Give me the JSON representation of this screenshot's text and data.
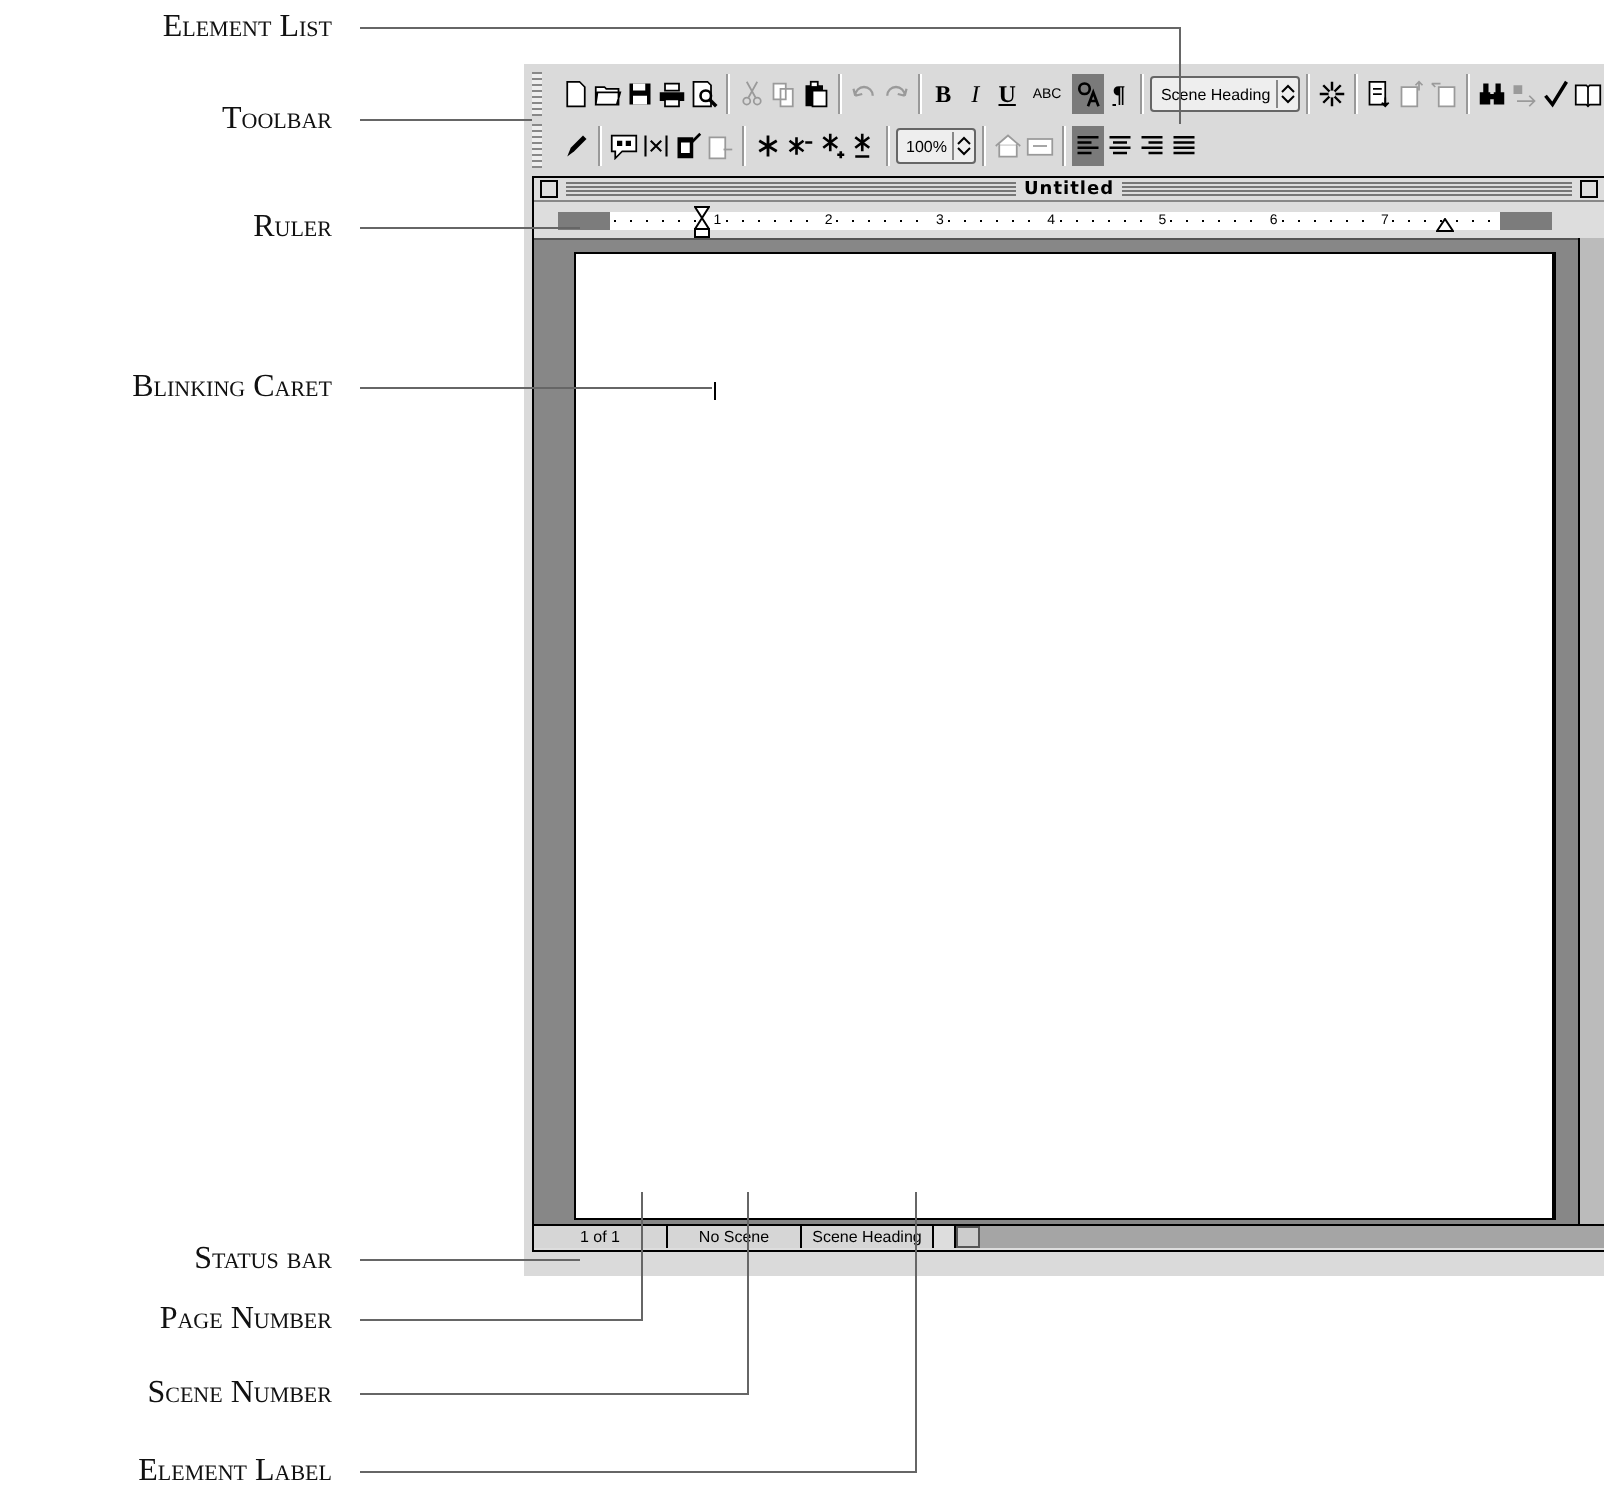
{
  "callouts": [
    {
      "label": "Element List"
    },
    {
      "label": "Toolbar"
    },
    {
      "label": "Ruler"
    },
    {
      "label": "Blinking Caret"
    },
    {
      "label": "Status bar"
    },
    {
      "label": "Page Number"
    },
    {
      "label": "Scene Number"
    },
    {
      "label": "Element Label"
    }
  ],
  "toolbar": {
    "rows": [
      [
        {
          "kind": "icon",
          "on": false,
          "disabled": false
        },
        {
          "kind": "icon",
          "on": false,
          "disabled": false
        },
        {
          "kind": "icon",
          "on": false,
          "disabled": false
        },
        {
          "kind": "icon",
          "on": false,
          "disabled": false
        },
        {
          "kind": "icon",
          "on": false,
          "disabled": false
        },
        {
          "kind": "separator"
        },
        {
          "kind": "icon",
          "on": false,
          "disabled": true
        },
        {
          "kind": "icon",
          "on": false,
          "disabled": true
        },
        {
          "kind": "icon",
          "on": false,
          "disabled": false
        },
        {
          "kind": "separator"
        },
        {
          "kind": "icon",
          "on": false,
          "disabled": true
        },
        {
          "kind": "icon",
          "on": false,
          "disabled": true
        },
        {
          "kind": "separator"
        },
        {
          "kind": "glyph",
          "text": "B",
          "on": false,
          "disabled": false
        },
        {
          "kind": "glyph",
          "text": "I",
          "on": false,
          "disabled": false
        },
        {
          "kind": "glyph",
          "text": "U",
          "on": false,
          "disabled": false
        },
        {
          "kind": "glyph",
          "text": "ABC",
          "on": false,
          "disabled": false
        },
        {
          "kind": "icon",
          "on": true,
          "disabled": false
        },
        {
          "kind": "glyph",
          "text": "¶",
          "on": false,
          "disabled": false
        },
        {
          "kind": "separator"
        },
        {
          "kind": "popup",
          "value": "Scene Heading"
        },
        {
          "kind": "separator"
        },
        {
          "kind": "icon",
          "on": false,
          "disabled": false
        },
        {
          "kind": "separator"
        },
        {
          "kind": "icon",
          "on": false,
          "disabled": false
        },
        {
          "kind": "icon",
          "on": false,
          "disabled": true
        },
        {
          "kind": "icon",
          "on": false,
          "disabled": true
        },
        {
          "kind": "separator"
        },
        {
          "kind": "icon",
          "on": false,
          "disabled": false
        },
        {
          "kind": "icon",
          "on": false,
          "disabled": true
        },
        {
          "kind": "icon",
          "on": false,
          "disabled": false
        },
        {
          "kind": "icon",
          "on": false,
          "disabled": false
        }
      ],
      [
        {
          "kind": "icon",
          "on": false,
          "disabled": false
        },
        {
          "kind": "separator"
        },
        {
          "kind": "icon",
          "on": false,
          "disabled": false
        },
        {
          "kind": "icon",
          "on": false,
          "disabled": false
        },
        {
          "kind": "icon",
          "on": false,
          "disabled": false
        },
        {
          "kind": "icon",
          "on": false,
          "disabled": true
        },
        {
          "kind": "separator"
        },
        {
          "kind": "icon",
          "on": false,
          "disabled": false
        },
        {
          "kind": "icon",
          "on": false,
          "disabled": false
        },
        {
          "kind": "icon",
          "on": false,
          "disabled": false
        },
        {
          "kind": "icon",
          "on": false,
          "disabled": false
        },
        {
          "kind": "separator"
        },
        {
          "kind": "popup",
          "value": "100%"
        },
        {
          "kind": "separator"
        },
        {
          "kind": "icon",
          "on": false,
          "disabled": true
        },
        {
          "kind": "icon",
          "on": false,
          "disabled": true
        },
        {
          "kind": "separator"
        },
        {
          "kind": "icon",
          "on": true,
          "disabled": false
        },
        {
          "kind": "icon",
          "on": false,
          "disabled": false
        },
        {
          "kind": "icon",
          "on": false,
          "disabled": false
        },
        {
          "kind": "icon",
          "on": false,
          "disabled": false
        }
      ]
    ]
  },
  "window": {
    "title": "Untitled"
  },
  "ruler": {
    "marks": [
      "1",
      "2",
      "3",
      "4",
      "5",
      "6",
      "7"
    ]
  },
  "status_bar": {
    "page": "1 of 1",
    "scene": "No Scene",
    "element": "Scene Heading"
  }
}
